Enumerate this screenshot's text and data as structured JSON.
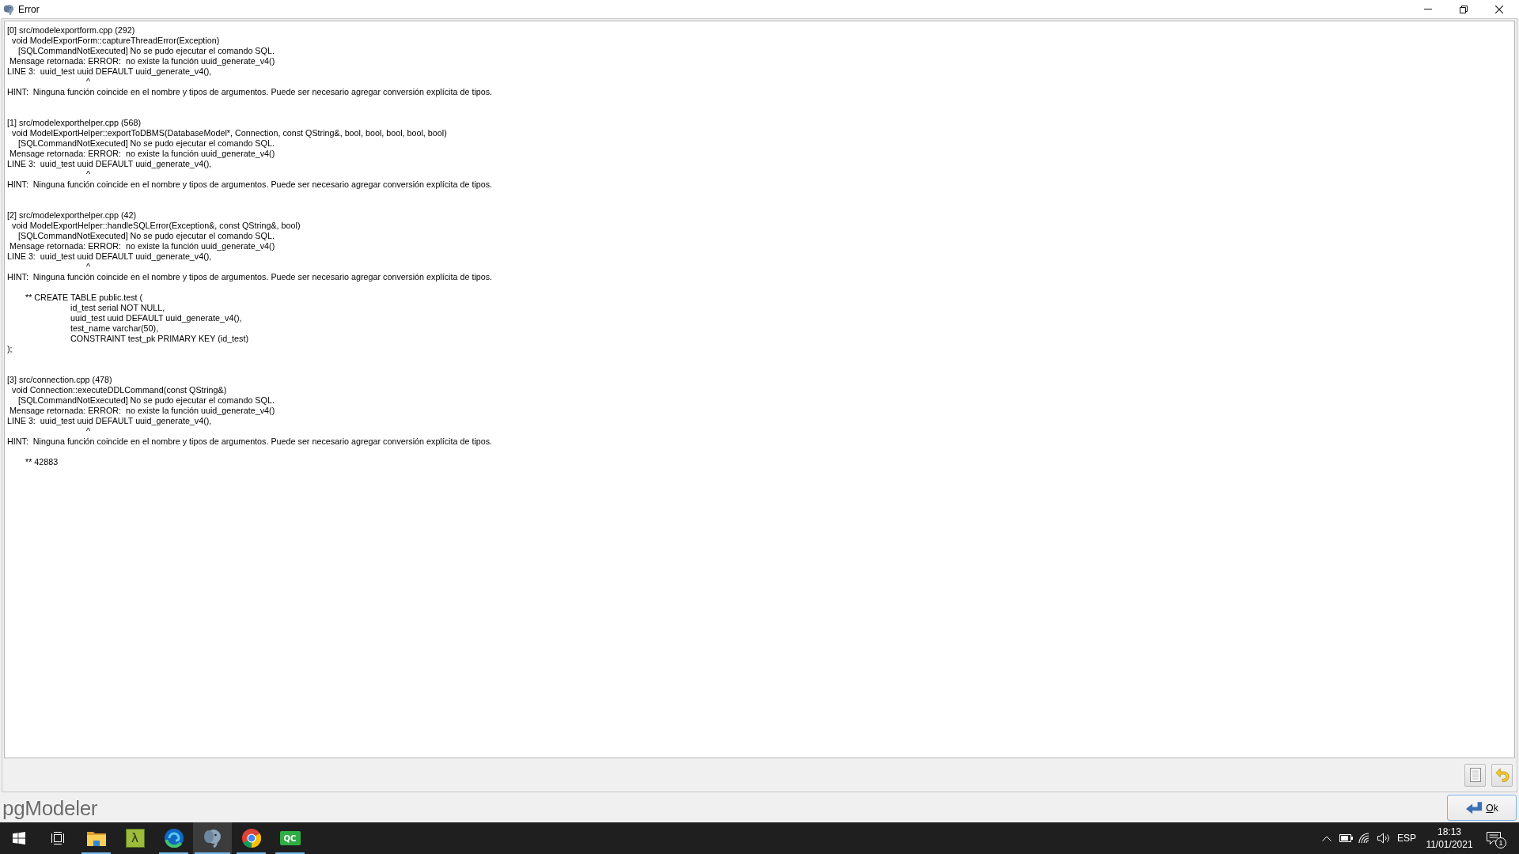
{
  "window": {
    "title": "Error"
  },
  "log": {
    "entries": [
      {
        "lines": [
          {
            "kind": "source",
            "text": "[0] src/modelexportform.cpp (292)"
          },
          {
            "kind": "function",
            "text": "void ModelExportForm::captureThreadError(Exception)"
          },
          {
            "kind": "error",
            "text": "[SQLCommandNotExecuted] No se pudo ejecutar el comando SQL."
          },
          {
            "kind": "message",
            "text": "Mensage retornada: ERROR:  no existe la función uuid_generate_v4()"
          },
          {
            "kind": "statement",
            "text": "LINE 3:  uuid_test uuid DEFAULT uuid_generate_v4(),"
          },
          {
            "kind": "caret",
            "text": "^"
          },
          {
            "kind": "hint",
            "text": "HINT:  Ninguna función coincide en el nombre y tipos de argumentos. Puede ser necesario agregar conversión explícita de tipos."
          }
        ]
      },
      {
        "lines": [
          {
            "kind": "source",
            "text": "[1] src/modelexporthelper.cpp (568)"
          },
          {
            "kind": "function",
            "text": "void ModelExportHelper::exportToDBMS(DatabaseModel*, Connection, const QString&, bool, bool, bool, bool, bool)"
          },
          {
            "kind": "error",
            "text": "[SQLCommandNotExecuted] No se pudo ejecutar el comando SQL."
          },
          {
            "kind": "message",
            "text": "Mensage retornada: ERROR:  no existe la función uuid_generate_v4()"
          },
          {
            "kind": "statement",
            "text": "LINE 3:  uuid_test uuid DEFAULT uuid_generate_v4(),"
          },
          {
            "kind": "caret",
            "text": "^"
          },
          {
            "kind": "hint",
            "text": "HINT:  Ninguna función coincide en el nombre y tipos de argumentos. Puede ser necesario agregar conversión explícita de tipos."
          }
        ]
      },
      {
        "lines": [
          {
            "kind": "source",
            "text": "[2] src/modelexporthelper.cpp (42)"
          },
          {
            "kind": "function",
            "text": "void ModelExportHelper::handleSQLError(Exception&, const QString&, bool)"
          },
          {
            "kind": "error",
            "text": "[SQLCommandNotExecuted] No se pudo ejecutar el comando SQL."
          },
          {
            "kind": "message",
            "text": "Mensage retornada: ERROR:  no existe la función uuid_generate_v4()"
          },
          {
            "kind": "statement",
            "text": "LINE 3:  uuid_test uuid DEFAULT uuid_generate_v4(),"
          },
          {
            "kind": "caret",
            "text": "^"
          },
          {
            "kind": "hint",
            "text": "HINT:  Ninguna función coincide en el nombre y tipos de argumentos. Puede ser necesario agregar conversión explícita de tipos."
          },
          {
            "kind": "note",
            "text": "** CREATE TABLE public.test ("
          },
          {
            "kind": "sql",
            "text": "id_test serial NOT NULL,"
          },
          {
            "kind": "sql",
            "text": "uuid_test uuid DEFAULT uuid_generate_v4(),"
          },
          {
            "kind": "sql",
            "text": "test_name varchar(50),"
          },
          {
            "kind": "sql",
            "text": "CONSTRAINT test_pk PRIMARY KEY (id_test)"
          },
          {
            "kind": "close",
            "text": ");"
          }
        ]
      },
      {
        "lines": [
          {
            "kind": "source",
            "text": "[3] src/connection.cpp (478)"
          },
          {
            "kind": "function",
            "text": "void Connection::executeDDLCommand(const QString&)"
          },
          {
            "kind": "error",
            "text": "[SQLCommandNotExecuted] No se pudo ejecutar el comando SQL."
          },
          {
            "kind": "message",
            "text": "Mensage retornada: ERROR:  no existe la función uuid_generate_v4()"
          },
          {
            "kind": "statement",
            "text": "LINE 3:  uuid_test uuid DEFAULT uuid_generate_v4(),"
          },
          {
            "kind": "caret",
            "text": "^"
          },
          {
            "kind": "hint",
            "text": "HINT:  Ninguna función coincide en el nombre y tipos de argumentos. Puede ser necesario agregar conversión explícita de tipos."
          },
          {
            "kind": "note",
            "text": "** 42883"
          }
        ]
      }
    ]
  },
  "logo": "pgModeler",
  "ok_button": {
    "label": "Ok"
  },
  "taskbar": {
    "apps": [
      {
        "kind": "folder",
        "running": true,
        "selected": false
      },
      {
        "kind": "lambda",
        "label": "λ",
        "running": false,
        "selected": false
      },
      {
        "kind": "swirl",
        "running": true,
        "selected": false
      },
      {
        "kind": "elephant",
        "running": true,
        "selected": true
      },
      {
        "kind": "wheel",
        "running": true,
        "selected": false
      },
      {
        "kind": "qc",
        "label": "QC",
        "running": true,
        "selected": false
      }
    ],
    "tray": {
      "language": "ESP",
      "time": "18:13",
      "date": "11/01/2021",
      "notifications": "1"
    }
  }
}
